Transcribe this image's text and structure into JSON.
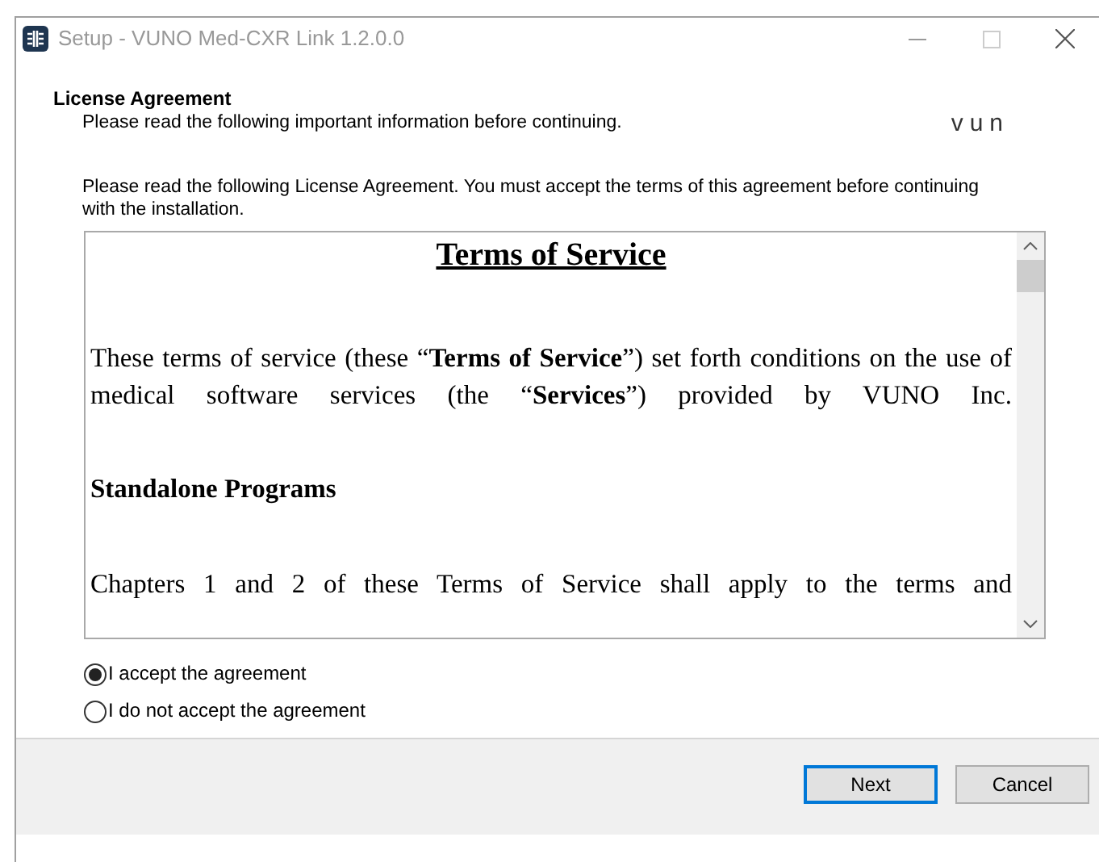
{
  "window": {
    "title": "Setup - VUNO Med-CXR Link 1.2.0.0"
  },
  "header": {
    "title": "License Agreement",
    "subtitle": "Please read the following important information before continuing.",
    "logo": "vun"
  },
  "instructions": "Please read the following License Agreement. You must accept the terms of this agreement before continuing with the installation.",
  "license": {
    "title": "Terms of Service",
    "blocks": [
      {
        "kind": "text",
        "text": "These terms of service (these “**Terms of Service**”) set forth conditions on the use of medical software services (the “**Services**”) provided by VUNO Inc."
      },
      {
        "kind": "heading",
        "text": "Standalone Programs"
      },
      {
        "kind": "text",
        "text": "Chapters 1 and 2 of these Terms of Service shall apply to the terms and"
      }
    ]
  },
  "options": [
    {
      "label": "I accept the agreement",
      "selected": true
    },
    {
      "label": "I do not accept the agreement",
      "selected": false
    }
  ],
  "buttons": [
    {
      "label": "Next",
      "default": true
    },
    {
      "label": "Cancel",
      "default": false
    }
  ]
}
